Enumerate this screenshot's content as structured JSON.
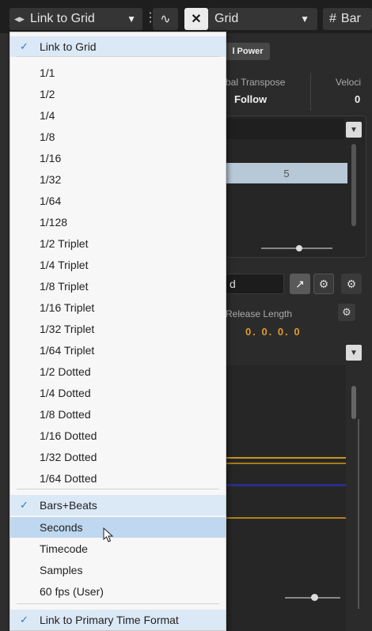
{
  "toolbar": {
    "link_label": "Link to Grid",
    "grid_label": "Grid",
    "bar_label": "Bar"
  },
  "background": {
    "power_button": "l Power",
    "global_transpose_label": "bal Transpose",
    "global_transpose_value": "Follow",
    "velocity_label": "Veloci",
    "velocity_value": "0",
    "lane_value": "5",
    "input_value": "d",
    "release_length_label": "Release Length",
    "release_length_value": "0. 0. 0.   0"
  },
  "menu": {
    "items": [
      {
        "label": "Link to Grid",
        "checked": true,
        "hover": false
      },
      {
        "label": "1/1",
        "checked": false,
        "hover": false
      },
      {
        "label": "1/2",
        "checked": false,
        "hover": false
      },
      {
        "label": "1/4",
        "checked": false,
        "hover": false
      },
      {
        "label": "1/8",
        "checked": false,
        "hover": false
      },
      {
        "label": "1/16",
        "checked": false,
        "hover": false
      },
      {
        "label": "1/32",
        "checked": false,
        "hover": false
      },
      {
        "label": "1/64",
        "checked": false,
        "hover": false
      },
      {
        "label": "1/128",
        "checked": false,
        "hover": false
      },
      {
        "label": "1/2  Triplet",
        "checked": false,
        "hover": false
      },
      {
        "label": "1/4  Triplet",
        "checked": false,
        "hover": false
      },
      {
        "label": "1/8  Triplet",
        "checked": false,
        "hover": false
      },
      {
        "label": "1/16  Triplet",
        "checked": false,
        "hover": false
      },
      {
        "label": "1/32  Triplet",
        "checked": false,
        "hover": false
      },
      {
        "label": "1/64  Triplet",
        "checked": false,
        "hover": false
      },
      {
        "label": "1/2  Dotted",
        "checked": false,
        "hover": false
      },
      {
        "label": "1/4  Dotted",
        "checked": false,
        "hover": false
      },
      {
        "label": "1/8  Dotted",
        "checked": false,
        "hover": false
      },
      {
        "label": "1/16  Dotted",
        "checked": false,
        "hover": false
      },
      {
        "label": "1/32  Dotted",
        "checked": false,
        "hover": false
      },
      {
        "label": "1/64  Dotted",
        "checked": false,
        "hover": false
      },
      {
        "label": "Bars+Beats",
        "checked": true,
        "hover": false
      },
      {
        "label": "Seconds",
        "checked": false,
        "hover": true
      },
      {
        "label": "Timecode",
        "checked": false,
        "hover": false
      },
      {
        "label": "Samples",
        "checked": false,
        "hover": false
      },
      {
        "label": "60 fps (User)",
        "checked": false,
        "hover": false
      },
      {
        "label": "Link to Primary Time Format",
        "checked": true,
        "hover": false
      }
    ]
  },
  "colors": {
    "accent_check": "#2b78c8",
    "hover_bg": "#bfd7ef",
    "checked_bg": "#dbe8f6",
    "orange_value": "#e09a2a"
  }
}
